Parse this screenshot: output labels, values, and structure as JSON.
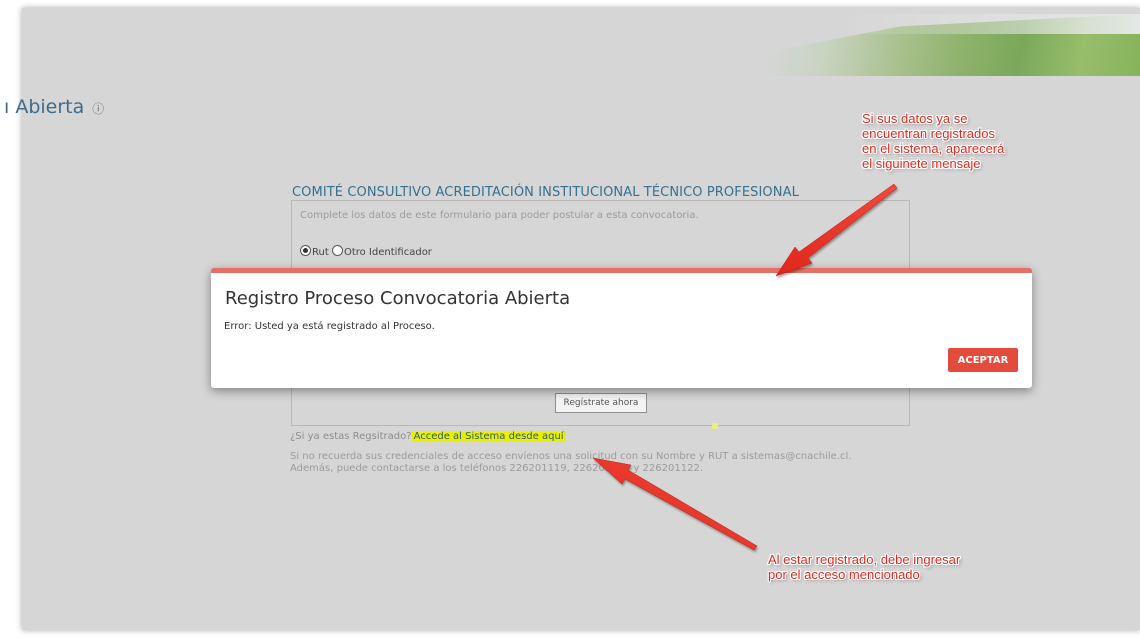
{
  "page": {
    "heading": "ı Abierta",
    "heading_info_icon": "info-icon"
  },
  "form": {
    "title": "COMITÉ CONSULTIVO ACREDITACIÓN INSTITUCIONAL TÉCNICO PROFESIONAL",
    "description": "Complete los datos de este formulario para poder postular a esta convocatoria.",
    "radio_rut": "Rut",
    "radio_other": "Otro Identificador",
    "register_button": "Regístrate ahora",
    "already_registered": "¿Si ya estas Regsitrado?",
    "access_link": "Accede al Sistema desde aquí",
    "note_line1": "Si no recuerda sus credenciales de acceso envíenos una solicitud con su Nombre y RUT a sistemas@cnachile.cl.",
    "note_line2": "Además, puede contactarse a los teléfonos 226201119, 226201121 y 226201122."
  },
  "modal": {
    "title": "Registro Proceso Convocatoria Abierta",
    "message": "Error: Usted ya está registrado al Proceso.",
    "accept_button": "ACEPTAR"
  },
  "annotations": {
    "top": {
      "line1": "Si sus datos ya se",
      "line2": "encuentran registrados",
      "line3": "en el sistema, aparecerá",
      "line4": "el siguinete mensaje"
    },
    "bottom": {
      "line1": "Al estar registrado, debe ingresar",
      "line2": "por el acceso mencionado"
    }
  },
  "colors": {
    "accent_blue": "#35708e",
    "modal_border": "#e76f64",
    "accept_button": "#e34b3c",
    "annotation_red": "#e02a1f",
    "highlight_yellow": "#e8f000"
  }
}
